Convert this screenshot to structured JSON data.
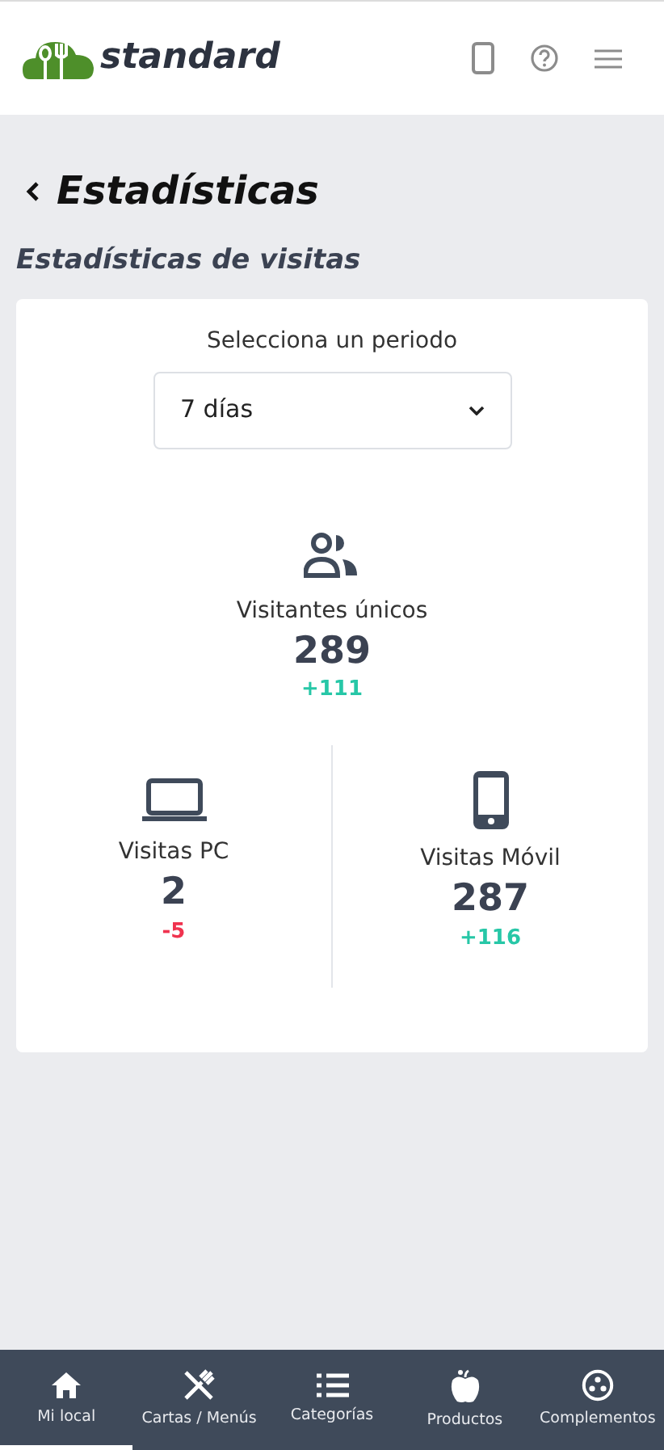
{
  "header": {
    "brand": "standard"
  },
  "page": {
    "title": "Estadísticas"
  },
  "section": {
    "title": "Estadísticas de visitas"
  },
  "period": {
    "label": "Selecciona un periodo",
    "value": "7 días"
  },
  "main_stat": {
    "kind": "users",
    "label": "Visitantes únicos",
    "value": "289",
    "delta": "+111",
    "color": "#27c7a7"
  },
  "stats": [
    {
      "kind": "laptop",
      "label": "Visitas PC",
      "value": "2",
      "delta": "-5",
      "color": "#f0334f"
    },
    {
      "kind": "phone",
      "label": "Visitas Móvil",
      "value": "287",
      "delta": "+116",
      "color": "#27c7a7"
    }
  ],
  "nav": [
    {
      "kind": "home",
      "label": "Mi local",
      "selected": true
    },
    {
      "kind": "utensils",
      "label": "Cartas / Menús",
      "selected": false
    },
    {
      "kind": "list",
      "label": "Categorías",
      "selected": false
    },
    {
      "kind": "apple",
      "label": "Productos",
      "selected": false
    },
    {
      "kind": "dots",
      "label": "Complementos",
      "selected": false
    }
  ]
}
